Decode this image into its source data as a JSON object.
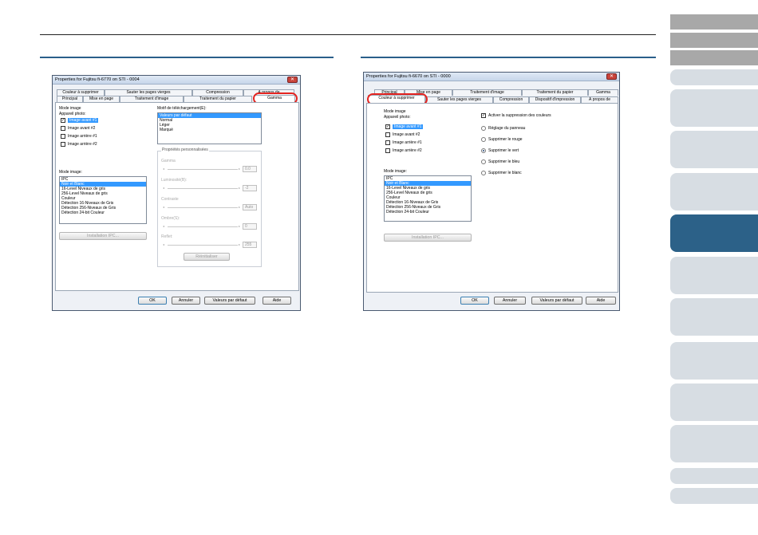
{
  "left_dialog": {
    "title": "Properties for Fujitsu fi-6770 on STI - 0004",
    "tabs_row1": [
      "Couleur à supprimer",
      "Sauter les pages vierges",
      "Compression",
      "À propos de"
    ],
    "tabs_row2": [
      "Principal",
      "Mise en page",
      "Traitement d'image",
      "Traitement du papier",
      "Gamma"
    ],
    "mode_image_label": "Mode image",
    "appareil_label": "Appareil photo:",
    "cameras": [
      "Image avant #1",
      "Image avant #2",
      "Image arrière #1",
      "Image arrière #2"
    ],
    "mode_image_list_label": "Mode image:",
    "modes": [
      "IPC",
      "Noir et Blanc",
      "16-Level Niveaux de gris",
      "256-Level Niveaux de gris",
      "Couleur",
      "Détection 16-Niveaux de Gris",
      "Détection 256-Niveaux de Gris",
      "Détection 24-bit Couleur"
    ],
    "installation_button": "Installation IPC...",
    "motif_label": "Motif de téléchargement(E):",
    "motifs": [
      "Valeurs par défaut",
      "Normal",
      "Léger",
      "Marqué"
    ],
    "custom_group": "Propriétés personnalisées",
    "sliders": [
      {
        "label": "Gamma",
        "value": "0.0"
      },
      {
        "label": "Luminosité(B):",
        "value": "-2"
      },
      {
        "label": "Contraste",
        "value": "Auto"
      },
      {
        "label": "Ombre(S):",
        "value": "0"
      },
      {
        "label": "Reflet:",
        "value": "255"
      }
    ],
    "reset_button": "Réinitialiser",
    "ok": "OK",
    "cancel": "Annuler",
    "defaults": "Valeurs par défaut",
    "help": "Aide"
  },
  "right_dialog": {
    "title": "Properties for Fujitsu fi-6670 on STI - 0000",
    "tabs_row1": [
      "Principal",
      "Mise en page",
      "Traitement d'image",
      "Traitement du papier",
      "Gamma"
    ],
    "tabs_row2": [
      "Couleur à supprimer",
      "Sauter les pages vierges",
      "Compression",
      "Dispositif d'impression",
      "À propos de"
    ],
    "mode_image_label": "Mode image",
    "appareil_label": "Appareil photo:",
    "cameras": [
      "Image avant #1",
      "Image avant #2",
      "Image arrière #1",
      "Image arrière #2"
    ],
    "mode_image_list_label": "Mode image:",
    "modes": [
      "IPC",
      "Noir et Blanc",
      "16-Level Niveaux de gris",
      "256-Level Niveaux de gris",
      "Couleur",
      "Détection 16-Niveaux de Gris",
      "Détection 256-Niveaux de Gris",
      "Détection 24-bit Couleur"
    ],
    "installation_button": "Installation IPC...",
    "activate_label": "Activer la suppression des couleurs",
    "radios": [
      "Réglage du panneau",
      "Supprimer le rouge",
      "Supprimer le vert",
      "Supprimer le bleu",
      "Supprimer le blanc"
    ],
    "ok": "OK",
    "cancel": "Annuler",
    "defaults": "Valeurs par défaut",
    "help": "Aide"
  },
  "colors": {
    "highlight_oval": "#e52420",
    "active_nav": "#2c6188",
    "selection": "#3399ff"
  }
}
